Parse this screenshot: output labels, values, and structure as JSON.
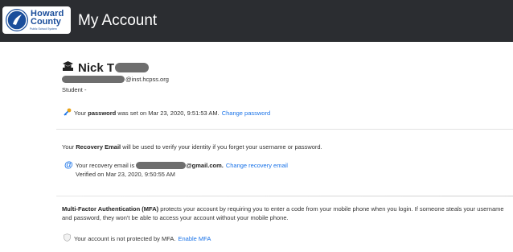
{
  "header": {
    "logo": {
      "line1": "Howard",
      "line2": "County",
      "line3": "Public School System"
    },
    "title": "My Account"
  },
  "profile": {
    "name": "Nick T",
    "email_suffix": "@inst.hcpss.org",
    "role": "Student -"
  },
  "password": {
    "prefix": "Your ",
    "bold": "password",
    "text": " was set on Mar 23, 2020, 9:51:53 AM.",
    "link": "Change password"
  },
  "recovery": {
    "desc_prefix": "Your ",
    "desc_bold": "Recovery Email",
    "desc_text": " will be used to verify your identity if you forget your username or password.",
    "email_prefix": "Your recovery email is ",
    "email_suffix": "@gmail.com.",
    "link": "Change recovery email",
    "verified": "Verified on Mar 23, 2020, 9:50:55 AM"
  },
  "mfa": {
    "desc_bold": "Multi-Factor Authentication (MFA)",
    "desc_text": " protects your account by requiring you to enter a code from your mobile phone when you login. If someone steals your username and password, they won't be able to access your account without your mobile phone.",
    "status": "Your account is not protected by MFA.",
    "link": "Enable MFA"
  },
  "colors": {
    "accent": "#1a73e8",
    "topbar": "#2b2d31",
    "brand": "#1b4e9b"
  }
}
